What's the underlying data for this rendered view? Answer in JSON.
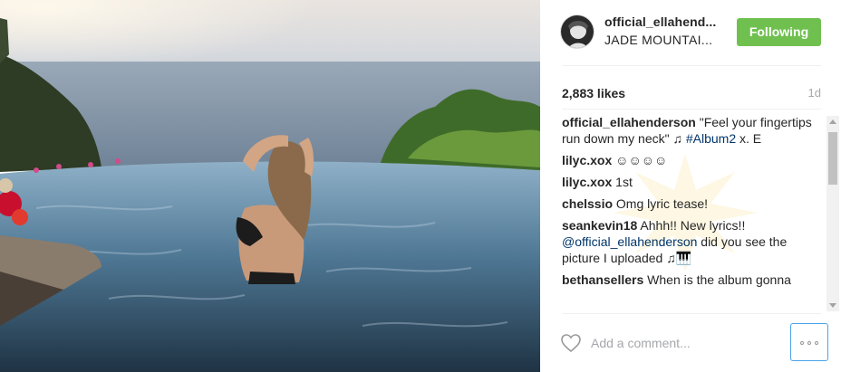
{
  "post": {
    "username": "official_ellahend...",
    "location": "JADE MOUNTAI...",
    "follow_label": "Following",
    "likes": "2,883 likes",
    "age": "1d"
  },
  "comments": [
    {
      "user": "official_ellahenderson",
      "text": " \"Feel your fingertips run down my neck\" ♫ ",
      "tag": "#Album2",
      "tail": " x. E"
    },
    {
      "user": "lilyc.xox",
      "text": " ☺☺☺☺"
    },
    {
      "user": "lilyc.xox",
      "text": " 1st"
    },
    {
      "user": "chelssio",
      "text": " Omg lyric tease!"
    },
    {
      "user": "seankevin18",
      "text": " Ahhh!! New lyrics!! ",
      "tag": "@official_ellahenderson",
      "tail": " did you see the picture I uploaded ♫🎹"
    },
    {
      "user": "bethansellers",
      "text": " When is the album gonna"
    }
  ],
  "composer": {
    "placeholder": "Add a comment...",
    "more_icon": "ellipsis-icon",
    "like_icon": "heart-icon"
  },
  "colors": {
    "follow": "#70c050",
    "link": "#003569",
    "muted": "#a5a7aa"
  }
}
